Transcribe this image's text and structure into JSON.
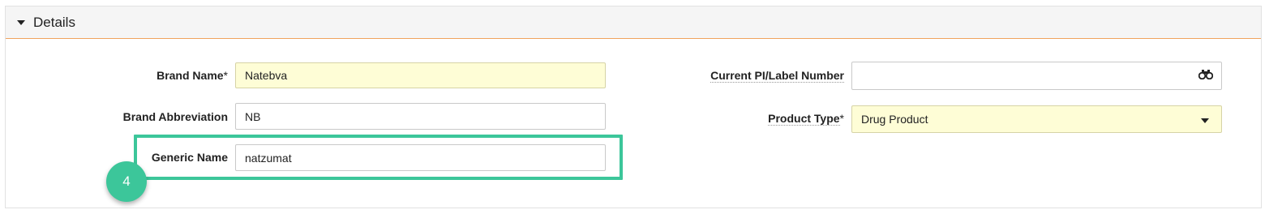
{
  "section": {
    "title": "Details"
  },
  "fields": {
    "brand_name": {
      "label": "Brand Name",
      "required_mark": "*",
      "value": "Natebva"
    },
    "brand_abbreviation": {
      "label": "Brand Abbreviation",
      "value": "NB"
    },
    "generic_name": {
      "label": "Generic Name",
      "value": "natzumat"
    },
    "current_pi_label_number": {
      "label": "Current PI/Label Number",
      "value": ""
    },
    "product_type": {
      "label": "Product Type",
      "required_mark": "*",
      "value": "Drug Product"
    }
  },
  "step_badge": {
    "number": "4",
    "color": "#3cc69a"
  },
  "colors": {
    "required_field_bg": "#fefdd6",
    "header_underline": "#f0a35e",
    "highlight": "#3cc69a"
  },
  "icons": {
    "section_toggle": "caret-down-icon",
    "lookup": "binoculars-icon",
    "dropdown": "chevron-down-icon"
  }
}
